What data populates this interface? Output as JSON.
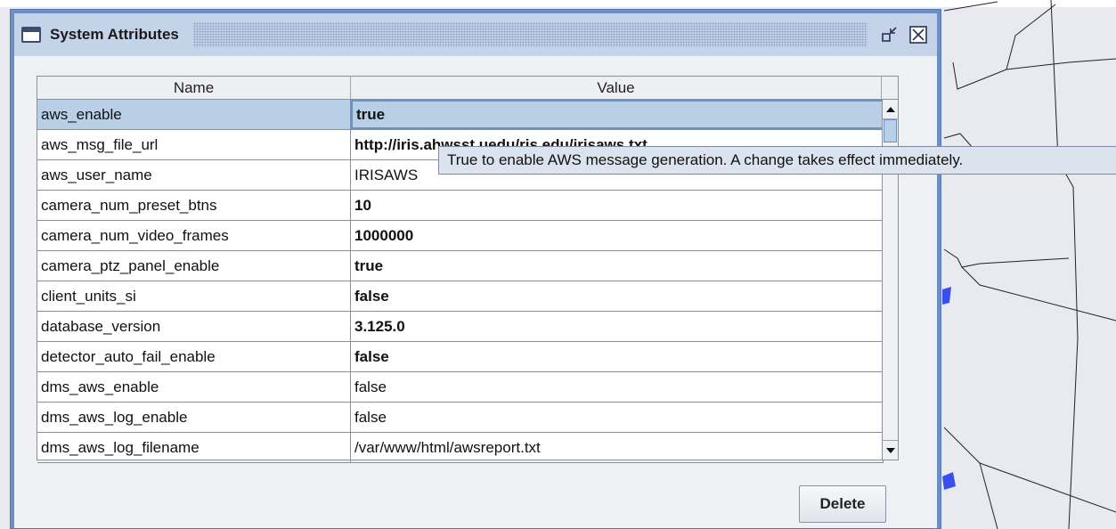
{
  "window": {
    "title": "System Attributes",
    "icon": "window-icon"
  },
  "table": {
    "columns": [
      "Name",
      "Value"
    ],
    "rows": [
      {
        "name": "aws_enable",
        "value": "true",
        "bold": true,
        "selected": true
      },
      {
        "name": "aws_msg_file_url",
        "value": "http://iris.ahwsst.uedu/ris.edu/irisaws.txt",
        "bold": true,
        "selected": false
      },
      {
        "name": "aws_user_name",
        "value": "IRISAWS",
        "bold": false,
        "selected": false
      },
      {
        "name": "camera_num_preset_btns",
        "value": "10",
        "bold": true,
        "selected": false
      },
      {
        "name": "camera_num_video_frames",
        "value": "1000000",
        "bold": true,
        "selected": false
      },
      {
        "name": "camera_ptz_panel_enable",
        "value": "true",
        "bold": true,
        "selected": false
      },
      {
        "name": "client_units_si",
        "value": "false",
        "bold": true,
        "selected": false
      },
      {
        "name": "database_version",
        "value": "3.125.0",
        "bold": true,
        "selected": false
      },
      {
        "name": "detector_auto_fail_enable",
        "value": "false",
        "bold": true,
        "selected": false
      },
      {
        "name": "dms_aws_enable",
        "value": "false",
        "bold": false,
        "selected": false
      },
      {
        "name": "dms_aws_log_enable",
        "value": "false",
        "bold": false,
        "selected": false
      },
      {
        "name": "dms_aws_log_filename",
        "value": "/var/www/html/awsreport.txt",
        "bold": false,
        "selected": false
      }
    ]
  },
  "tooltip": {
    "text": "True to enable AWS message generation. A change takes effect immediately."
  },
  "buttons": {
    "delete_label": "Delete"
  },
  "colors": {
    "frame_border": "#6e8fc4",
    "title_bg": "#c4d3e8",
    "selection": "#b8cfe5",
    "map_bg": "#e9eaef",
    "map_marker": "#3a4ff0"
  }
}
